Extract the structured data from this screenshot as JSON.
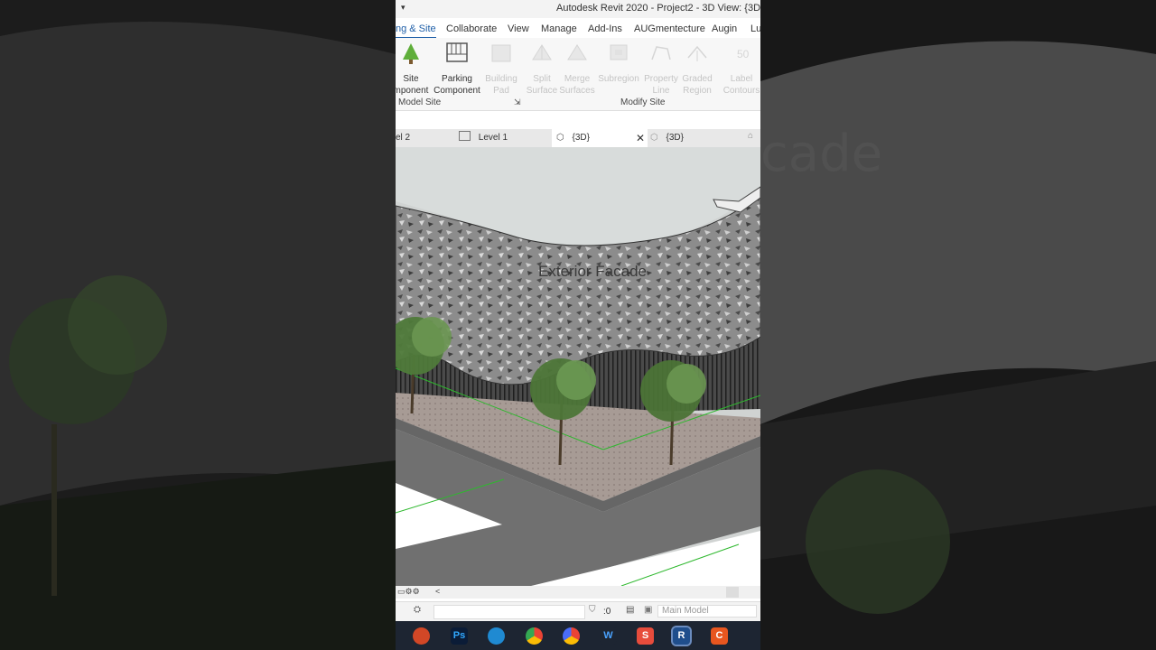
{
  "window": {
    "title": "Autodesk Revit 2020 - Project2 - 3D View: {3D}",
    "qat_icon": "dropdown-arrow-icon"
  },
  "ribbon_tabs": [
    {
      "label": "ng & Site",
      "active": true
    },
    {
      "label": "Collaborate"
    },
    {
      "label": "View"
    },
    {
      "label": "Manage"
    },
    {
      "label": "Add-Ins"
    },
    {
      "label": "AUGmentecture"
    },
    {
      "label": "Augin"
    },
    {
      "label": "Lu"
    }
  ],
  "ribbon": {
    "buttons": [
      {
        "line1": "Site",
        "line2": "mponent",
        "icon": "tree-icon",
        "enabled": true
      },
      {
        "line1": "Parking",
        "line2": "Component",
        "icon": "parking-icon",
        "enabled": true
      },
      {
        "line1": "Building",
        "line2": "Pad",
        "icon": "building-pad-icon",
        "enabled": false
      },
      {
        "line1": "Split",
        "line2": "Surface",
        "icon": "split-surface-icon",
        "enabled": false
      },
      {
        "line1": "Merge",
        "line2": "Surfaces",
        "icon": "merge-surfaces-icon",
        "enabled": false
      },
      {
        "line1": "Subregion",
        "line2": "",
        "icon": "subregion-icon",
        "enabled": false
      },
      {
        "line1": "Property",
        "line2": "Line",
        "icon": "property-line-icon",
        "enabled": false
      },
      {
        "line1": "Graded",
        "line2": "Region",
        "icon": "graded-region-icon",
        "enabled": false
      },
      {
        "line1": "Label",
        "line2": "Contours",
        "icon": "label-contours-icon",
        "enabled": false
      }
    ],
    "panels": {
      "model_site": "Model Site",
      "modify_site": "Modify Site"
    }
  },
  "view_tabs": [
    {
      "label": "el 2",
      "icon": ""
    },
    {
      "label": "Level 1",
      "icon": "floor-plan-icon"
    },
    {
      "label": "{3D}",
      "icon": "3d-cube-icon",
      "active": true,
      "close": "✕"
    },
    {
      "label": "{3D}",
      "icon": "3d-cube-icon"
    }
  ],
  "viewport": {
    "model_text": "Exterior Facade"
  },
  "status": {
    "nav_arrow": "<",
    "selection_count": ":0",
    "model_dropdown": "Main Model"
  },
  "taskbar": [
    {
      "name": "powerpoint-icon",
      "color": "#d24726",
      "glyph": ""
    },
    {
      "name": "photoshop-icon",
      "color": "#0b1c37",
      "glyph": "Ps"
    },
    {
      "name": "edge-icon",
      "color": "#1f8ad2",
      "glyph": ""
    },
    {
      "name": "chrome-icon",
      "color": "#34a853",
      "glyph": ""
    },
    {
      "name": "chrome-profile-icon",
      "color": "#4a6cf7",
      "glyph": ""
    },
    {
      "name": "webflow-icon",
      "color": "#1d2532",
      "glyph": "W"
    },
    {
      "name": "sketchup-icon",
      "color": "#e74c3c",
      "glyph": "S"
    },
    {
      "name": "revit-icon",
      "color": "#1f4e8c",
      "glyph": "R"
    },
    {
      "name": "app-c-icon",
      "color": "#e8561f",
      "glyph": "C"
    }
  ]
}
